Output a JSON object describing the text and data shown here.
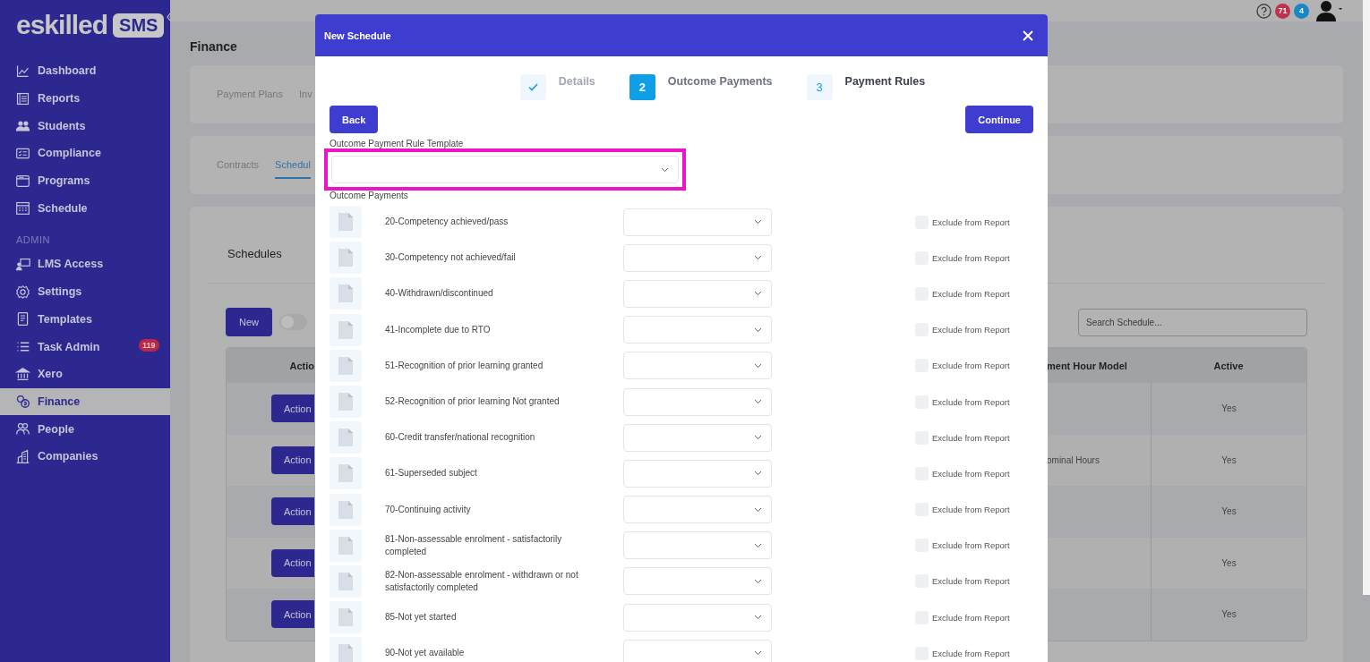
{
  "sidebar": {
    "logo": {
      "wordmark": "eskilled",
      "badge": "SMS"
    },
    "main_items": [
      {
        "label": "Dashboard",
        "selected": false
      },
      {
        "label": "Reports",
        "selected": false
      },
      {
        "label": "Students",
        "selected": false
      },
      {
        "label": "Compliance",
        "selected": false
      },
      {
        "label": "Programs",
        "selected": false
      },
      {
        "label": "Schedule",
        "selected": false
      }
    ],
    "admin_heading": "ADMIN",
    "admin_items": [
      {
        "label": "LMS Access",
        "selected": false
      },
      {
        "label": "Settings",
        "selected": false
      },
      {
        "label": "Templates",
        "selected": false
      },
      {
        "label": "Task Admin",
        "selected": false,
        "badge": "119"
      },
      {
        "label": "Xero",
        "selected": false
      },
      {
        "label": "Finance",
        "selected": true
      },
      {
        "label": "People",
        "selected": false
      },
      {
        "label": "Companies",
        "selected": false
      }
    ]
  },
  "top_bar": {
    "notification_badges": [
      {
        "count": "71",
        "color": "#c0304f"
      },
      {
        "count": "4",
        "color": "#1a86c6"
      }
    ]
  },
  "page": {
    "title": "Finance",
    "tabs": [
      {
        "label": "Payment Plans",
        "selected": false
      },
      {
        "label": "Inv",
        "selected": false
      }
    ],
    "subtabs": [
      {
        "label": "Contracts",
        "selected": false
      },
      {
        "label": "Schedul",
        "selected": true
      }
    ],
    "schedules": {
      "title": "Schedules",
      "new_button": "New",
      "toggle_on": false,
      "search_placeholder": "Search Schedule...",
      "columns": [
        "Actio",
        "ment Hour Model",
        "Active"
      ],
      "rows": [
        {
          "action": "Action",
          "active": "Yes"
        },
        {
          "action": "Action",
          "hour_model": "ominal Hours",
          "active": "Yes"
        },
        {
          "action": "Action",
          "active": "Yes"
        },
        {
          "action": "Action",
          "active": "Yes"
        },
        {
          "action": "Action",
          "active": "Yes"
        }
      ]
    }
  },
  "modal": {
    "title": "New Schedule",
    "steps": [
      {
        "completed": true,
        "selected": false,
        "label": "Details"
      },
      {
        "completed": false,
        "selected": true,
        "number": "2",
        "label": "Outcome Payments"
      },
      {
        "completed": false,
        "selected": false,
        "number": "3",
        "label": "Payment Rules"
      }
    ],
    "back_button": "Back",
    "continue_button": "Continue",
    "template_label": "Outcome Payment Rule Template",
    "template_highlighted": true,
    "payments_label": "Outcome Payments",
    "outcomes": [
      {
        "label": "20-Competency achieved/pass",
        "exclude_label": "Exclude from Report",
        "exclude_checked": false
      },
      {
        "label": "30-Competency not achieved/fail",
        "exclude_label": "Exclude from Report",
        "exclude_checked": false
      },
      {
        "label": "40-Withdrawn/discontinued",
        "exclude_label": "Exclude from Report",
        "exclude_checked": false
      },
      {
        "label": "41-Incomplete due to RTO",
        "exclude_label": "Exclude from Report",
        "exclude_checked": false
      },
      {
        "label": "51-Recognition of prior learning granted",
        "exclude_label": "Exclude from Report",
        "exclude_checked": false
      },
      {
        "label": "52-Recognition of prior learning Not granted",
        "exclude_label": "Exclude from Report",
        "exclude_checked": false
      },
      {
        "label": "60-Credit transfer/national recognition",
        "exclude_label": "Exclude from Report",
        "exclude_checked": false
      },
      {
        "label": "61-Superseded subject",
        "exclude_label": "Exclude from Report",
        "exclude_checked": false
      },
      {
        "label": "70-Continuing activity",
        "exclude_label": "Exclude from Report",
        "exclude_checked": false
      },
      {
        "label": "81-Non-assessable enrolment - satisfactorily completed",
        "exclude_label": "Exclude from Report",
        "exclude_checked": false
      },
      {
        "label": "82-Non-assessable enrolment - withdrawn or not satisfactorily completed",
        "exclude_label": "Exclude from Report",
        "exclude_checked": false
      },
      {
        "label": "85-Not yet started",
        "exclude_label": "Exclude from Report",
        "exclude_checked": false
      },
      {
        "label": "90-Not yet available",
        "exclude_label": "Exclude from Report",
        "exclude_checked": false
      }
    ]
  }
}
